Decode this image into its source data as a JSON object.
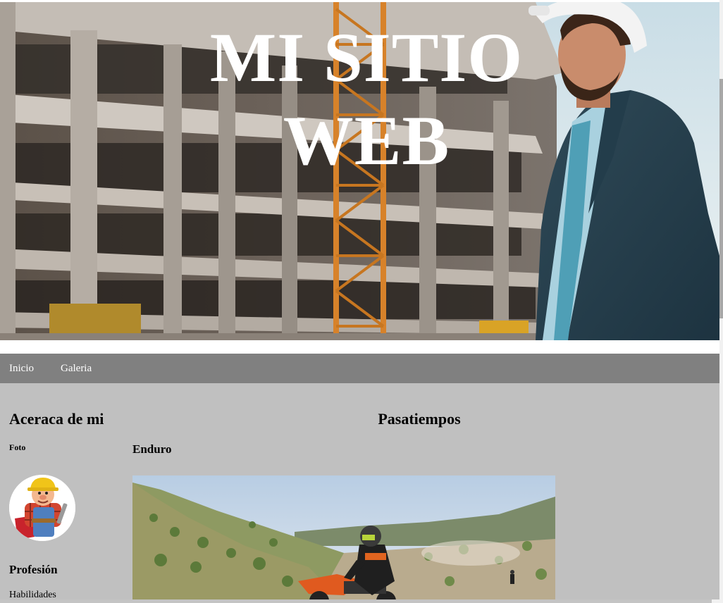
{
  "header": {
    "title": "MI SITIO WEB",
    "banner_image": "construction-engineer-photo"
  },
  "nav": {
    "items": [
      {
        "label": "Inicio"
      },
      {
        "label": "Galeria"
      }
    ]
  },
  "about": {
    "heading": "Aceraca de mi",
    "photo_label": "Foto",
    "avatar_image": "builder-cartoon-avatar",
    "profession_heading": "Profesión",
    "skills_label": "Habilidades"
  },
  "hobbies": {
    "heading": "Pasatiempos",
    "items": [
      {
        "title": "Enduro",
        "image": "enduro-motocross-photo"
      }
    ]
  },
  "colors": {
    "nav_bg": "#808080",
    "content_bg": "#c0c0c0",
    "title_text": "#ffffff"
  }
}
